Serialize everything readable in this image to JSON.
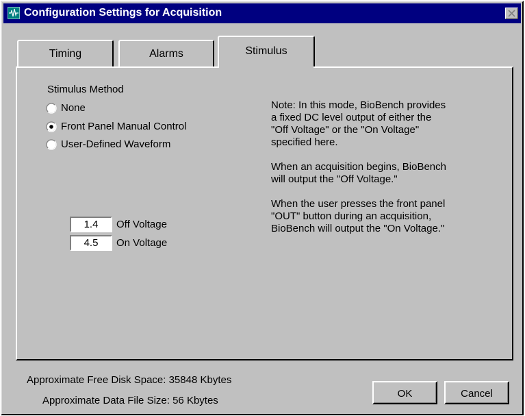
{
  "window": {
    "title": "Configuration Settings for Acquisition"
  },
  "tabs": [
    {
      "label": "Timing",
      "active": false
    },
    {
      "label": "Alarms",
      "active": false
    },
    {
      "label": "Stimulus",
      "active": true
    }
  ],
  "stimulus": {
    "section_label": "Stimulus Method",
    "options": [
      {
        "label": "None",
        "selected": false
      },
      {
        "label": "Front Panel Manual Control",
        "selected": true
      },
      {
        "label": "User-Defined Waveform",
        "selected": false
      }
    ],
    "note_lines": [
      "Note: In this mode, BioBench provides",
      "a fixed DC level output of either the",
      "\"Off Voltage\" or the \"On Voltage\"",
      "specified here.",
      "",
      "When an acquisition begins, BioBench",
      "will output the \"Off Voltage.\"",
      "",
      "When the user presses the front panel",
      "\"OUT\" button during an acquisition,",
      "BioBench will output the \"On Voltage.\""
    ],
    "off_voltage": {
      "value": "1.4",
      "label": "Off Voltage"
    },
    "on_voltage": {
      "value": "4.5",
      "label": "On Voltage"
    }
  },
  "footer": {
    "disk_space_label": "Approximate Free Disk Space:",
    "disk_space_value": "35848",
    "disk_space_unit": "Kbytes",
    "file_size_label": "Approximate Data File Size:",
    "file_size_value": "56",
    "file_size_unit": "Kbytes",
    "ok_label": "OK",
    "cancel_label": "Cancel"
  },
  "colors": {
    "titlebar": "#000080",
    "face": "#c0c0c0",
    "app_icon": "#008080"
  },
  "icons": {
    "app": "waveform-icon",
    "close": "close-icon"
  }
}
